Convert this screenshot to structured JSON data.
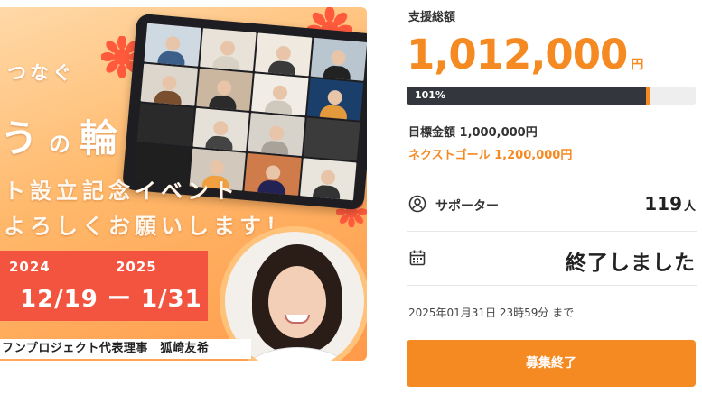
{
  "banner": {
    "line1": "つなぐ",
    "line2_left": "う",
    "line2_mid": "の",
    "line2_right": "輪",
    "line3": "ト設立記念イベント",
    "line4": "よろしくお願いします！",
    "date_start_year": "2024",
    "date_end_year": "2025",
    "date_range": "12/19 ー 1/31",
    "caption": "フンプロジェクト代表理事　狐崎友希"
  },
  "funding": {
    "total_label": "支援総額",
    "total_amount": "1,012,000",
    "total_unit": "円",
    "progress_percent": 101,
    "progress_label": "101%",
    "goal_text": "目標金額 1,000,000円",
    "next_goal_text": "ネクストゴール 1,200,000円"
  },
  "supporters": {
    "label": "サポーター",
    "count": "119",
    "unit": "人"
  },
  "status": {
    "text": "終了しました"
  },
  "deadline": "2025年01月31日 23時59分 まで",
  "button": {
    "label": "募集終了"
  },
  "colors": {
    "accent": "#f58a22",
    "bar_dark": "#34363d",
    "date_red": "#f3543f"
  }
}
